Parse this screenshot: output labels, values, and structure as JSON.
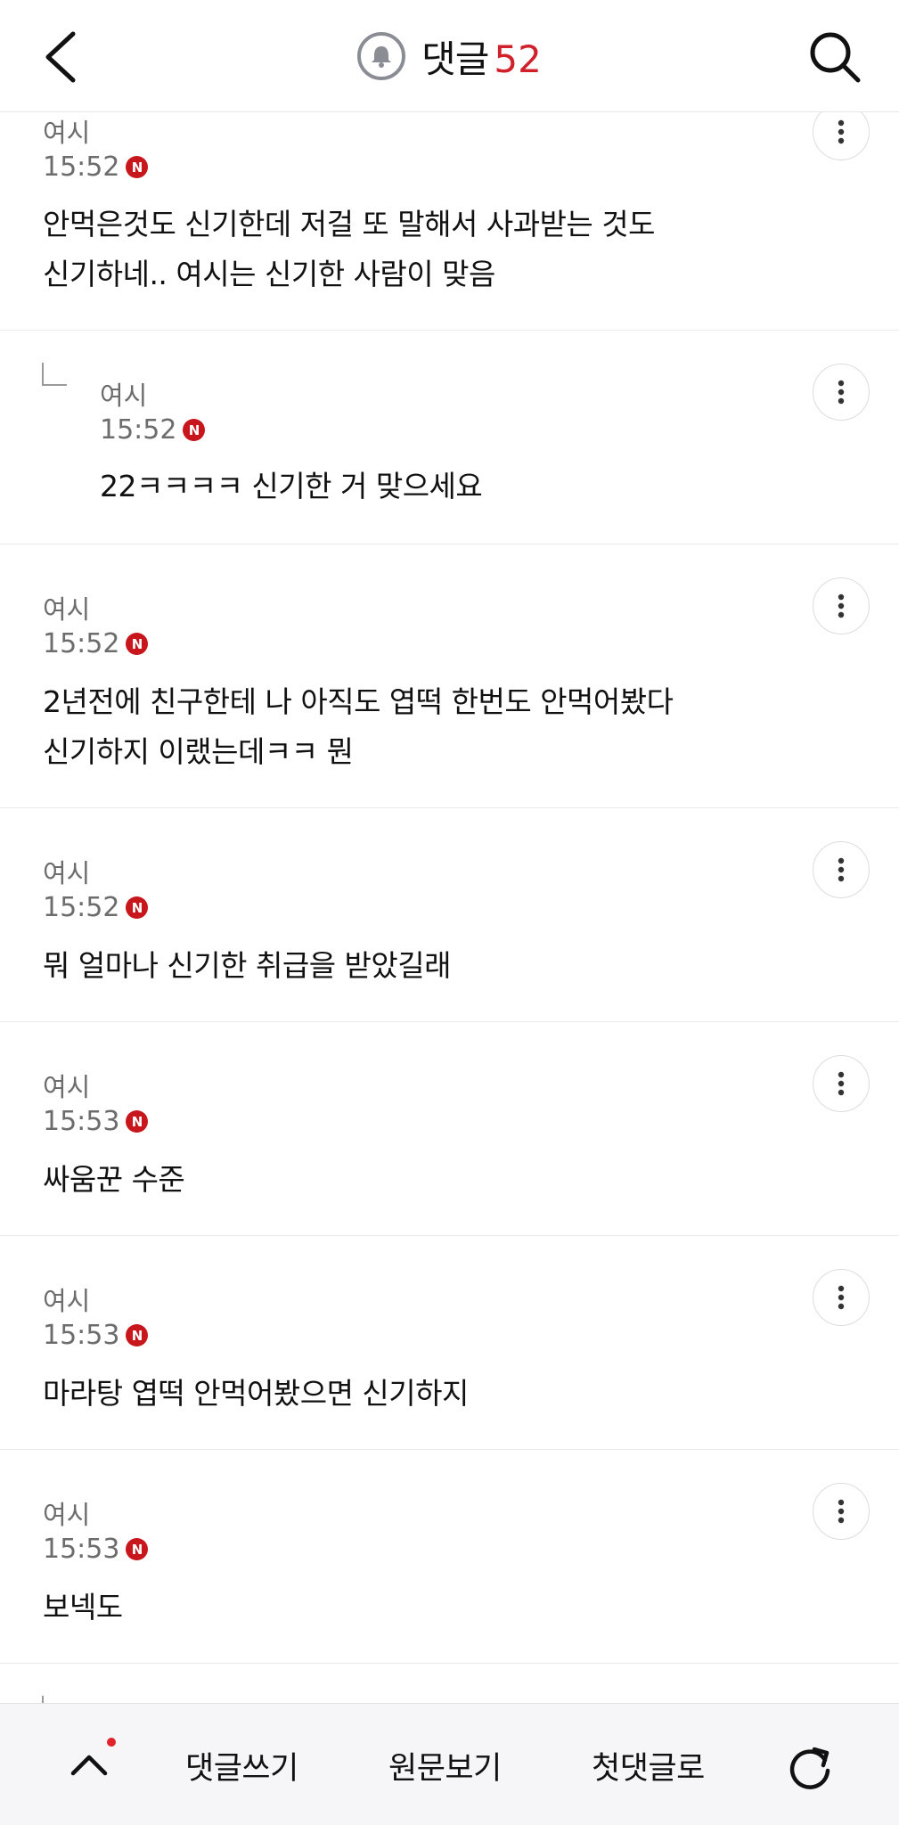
{
  "header": {
    "title": "댓글",
    "count": "52"
  },
  "comments": [
    {
      "author": "여시",
      "time": "15:52",
      "badge": "N",
      "lines": [
        "안먹은것도 신기한데 저걸 또 말해서 사과받는 것도",
        "신기하네.. 여시는 신기한 사람이 맞음"
      ]
    },
    {
      "author": "여시",
      "time": "15:52",
      "badge": "N",
      "lines": [
        "22ㅋㅋㅋㅋ 신기한 거 맞으세요"
      ]
    },
    {
      "author": "여시",
      "time": "15:52",
      "badge": "N",
      "lines": [
        "2년전에 친구한테 나 아직도 엽떡 한번도 안먹어봤다",
        "신기하지 이랬는데ㅋㅋ 뭔"
      ]
    },
    {
      "author": "여시",
      "time": "15:52",
      "badge": "N",
      "lines": [
        "뭐 얼마나 신기한 취급을 받았길래"
      ]
    },
    {
      "author": "여시",
      "time": "15:53",
      "badge": "N",
      "lines": [
        "싸움꾼 수준"
      ]
    },
    {
      "author": "여시",
      "time": "15:53",
      "badge": "N",
      "lines": [
        "마라탕 엽떡 안먹어봤으면 신기하지"
      ]
    },
    {
      "author": "여시",
      "time": "15:53",
      "badge": "N",
      "lines": [
        "보넥도"
      ]
    }
  ],
  "bottom_bar": {
    "write_label": "댓글쓰기",
    "original_label": "원문보기",
    "first_label": "첫댓글로"
  },
  "colors": {
    "accent": "#d0212b",
    "badge": "#c8161d",
    "meta_text": "#6c6c6c"
  }
}
